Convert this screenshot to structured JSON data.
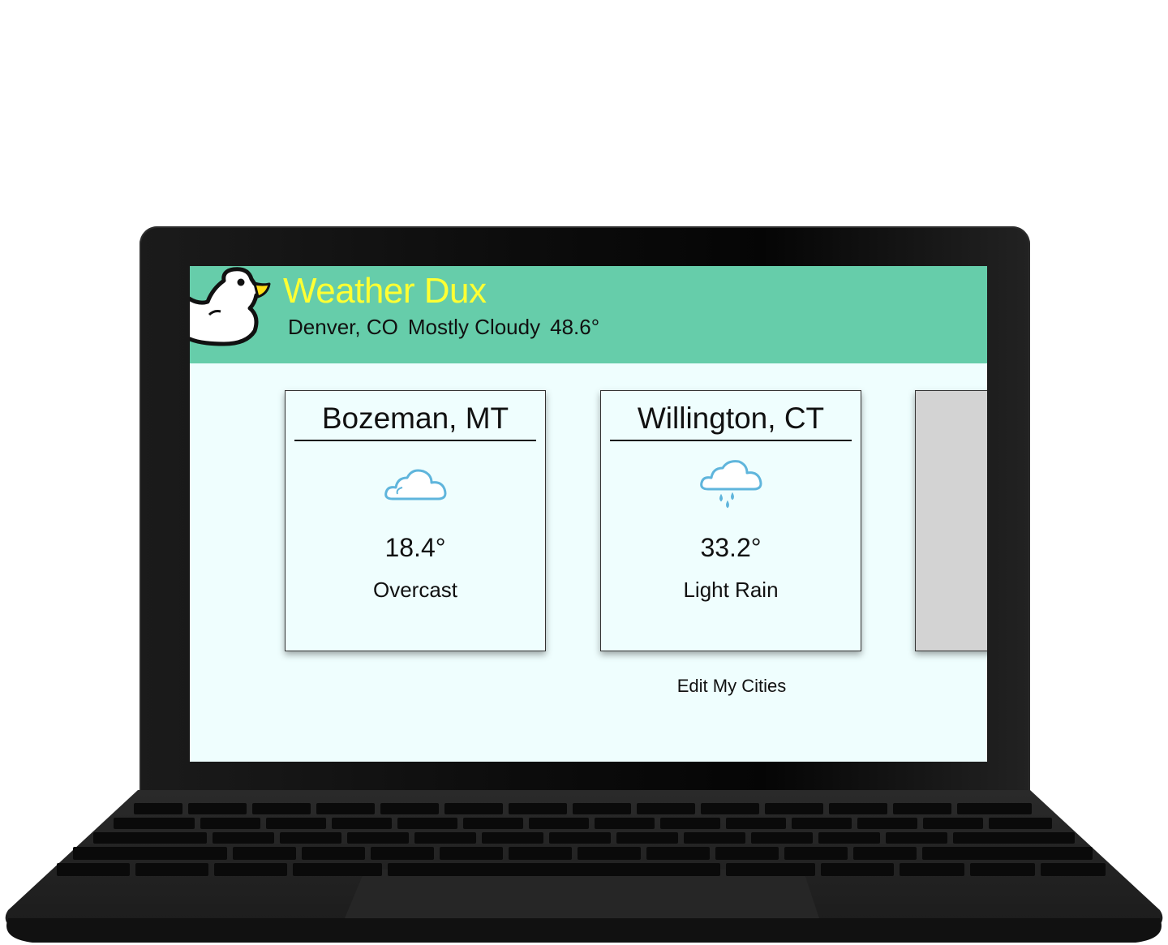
{
  "app": {
    "title": "Weather Dux",
    "logo_icon": "duck-icon",
    "colors": {
      "header_bg": "#66cdaa",
      "title": "#ffff33",
      "screen_bg": "#effefe",
      "placeholder_card": "#d3d3d3"
    }
  },
  "current": {
    "location": "Denver, CO",
    "condition": "Mostly Cloudy",
    "temperature": "48.6°"
  },
  "cities": [
    {
      "name": "Bozeman, MT",
      "icon": "cloud-icon",
      "temperature": "18.4°",
      "condition": "Overcast"
    },
    {
      "name": "Willington, CT",
      "icon": "rain-cloud-icon",
      "temperature": "33.2°",
      "condition": "Light Rain"
    }
  ],
  "actions": {
    "edit_label": "Edit My Cities"
  }
}
